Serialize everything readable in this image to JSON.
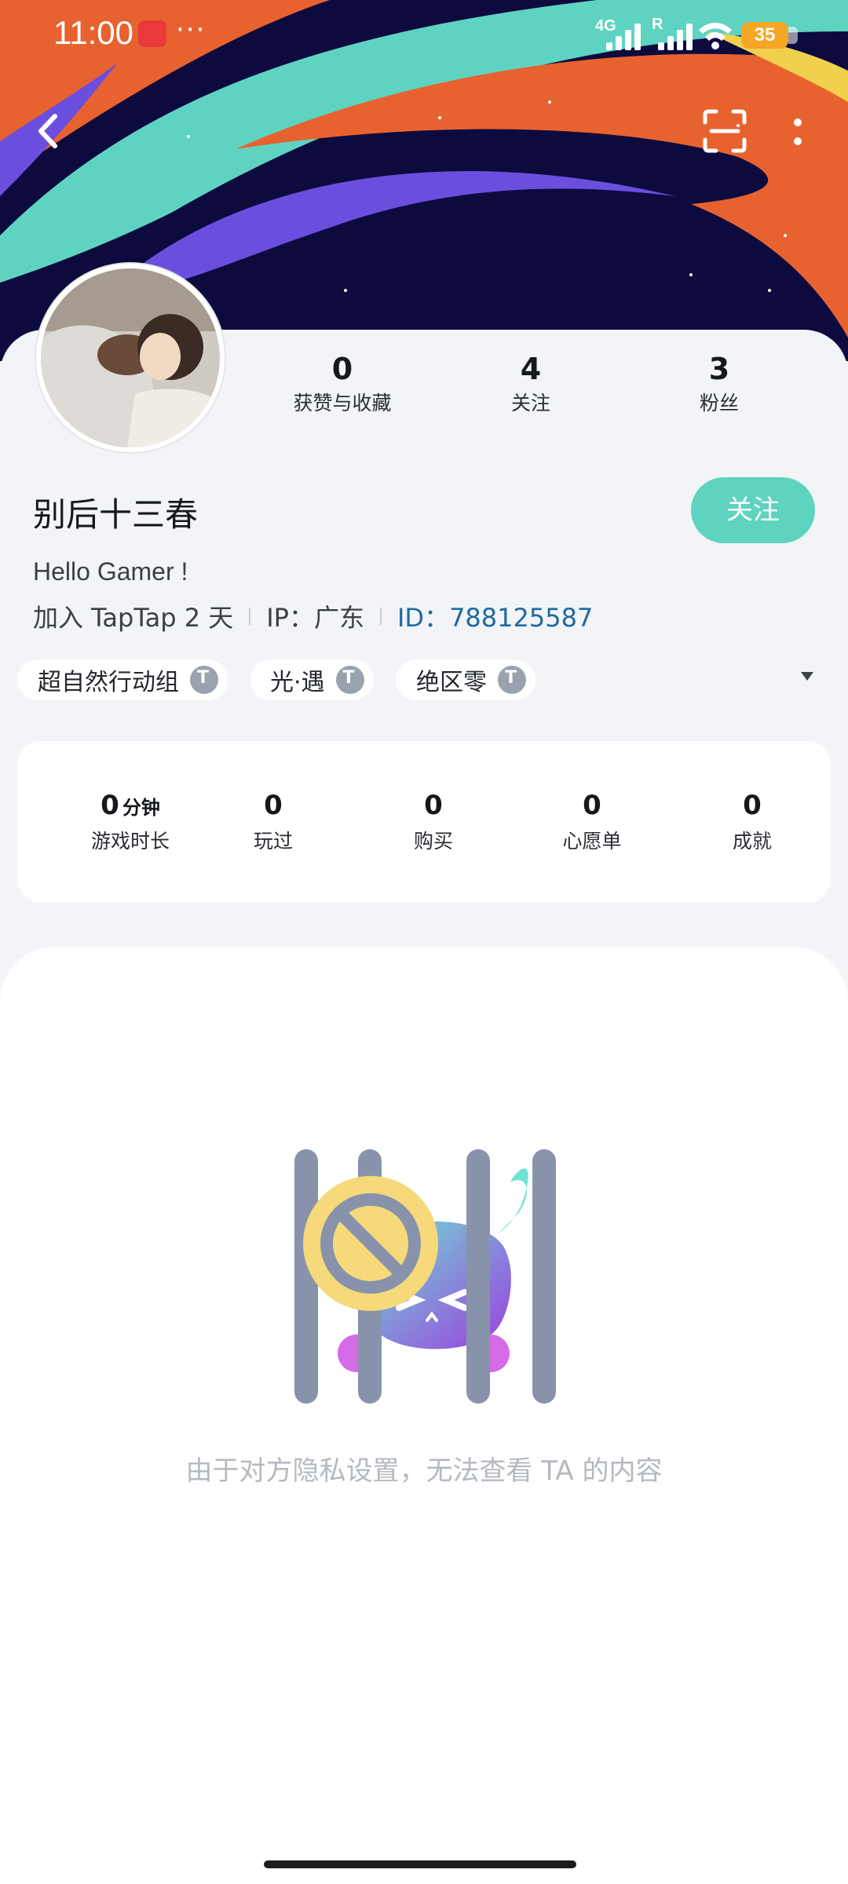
{
  "status_bar": {
    "time": "11:00",
    "dots": "···",
    "network_primary": "4G",
    "network_secondary": "R",
    "battery": "35",
    "icons": [
      "app-notification-icon",
      "signal-icon",
      "wifi-icon",
      "battery-icon"
    ]
  },
  "nav": {
    "icons": [
      "back-arrow-icon",
      "scan-icon",
      "more-vertical-icon"
    ]
  },
  "profile": {
    "stats": [
      {
        "value": "0",
        "label": "获赞与收藏"
      },
      {
        "value": "4",
        "label": "关注"
      },
      {
        "value": "3",
        "label": "粉丝"
      }
    ],
    "username": "别后十三春",
    "follow_label": "关注",
    "bio": "Hello Gamer !",
    "joined": "加入 TapTap 2 天",
    "ip": "IP：广东",
    "id": "ID：788125587",
    "tags": [
      "超自然行动组",
      "光·遇",
      "绝区零"
    ]
  },
  "game_stats": [
    {
      "value": "0",
      "unit": "分钟",
      "label": "游戏时长"
    },
    {
      "value": "0",
      "unit": "",
      "label": "玩过"
    },
    {
      "value": "0",
      "unit": "",
      "label": "购买"
    },
    {
      "value": "0",
      "unit": "",
      "label": "心愿单"
    },
    {
      "value": "0",
      "unit": "",
      "label": "成就"
    }
  ],
  "empty_state": {
    "message": "由于对方隐私设置，无法查看 TA 的内容",
    "illustration": "privacy-locked-illustration"
  },
  "colors": {
    "accent": "#5ed3bf",
    "id_link": "#1e6aa0",
    "banner_bg": "#0d0a3e",
    "banner_orange": "#e8622f",
    "banner_teal": "#5fd3c2",
    "banner_purple": "#6a4fde"
  }
}
